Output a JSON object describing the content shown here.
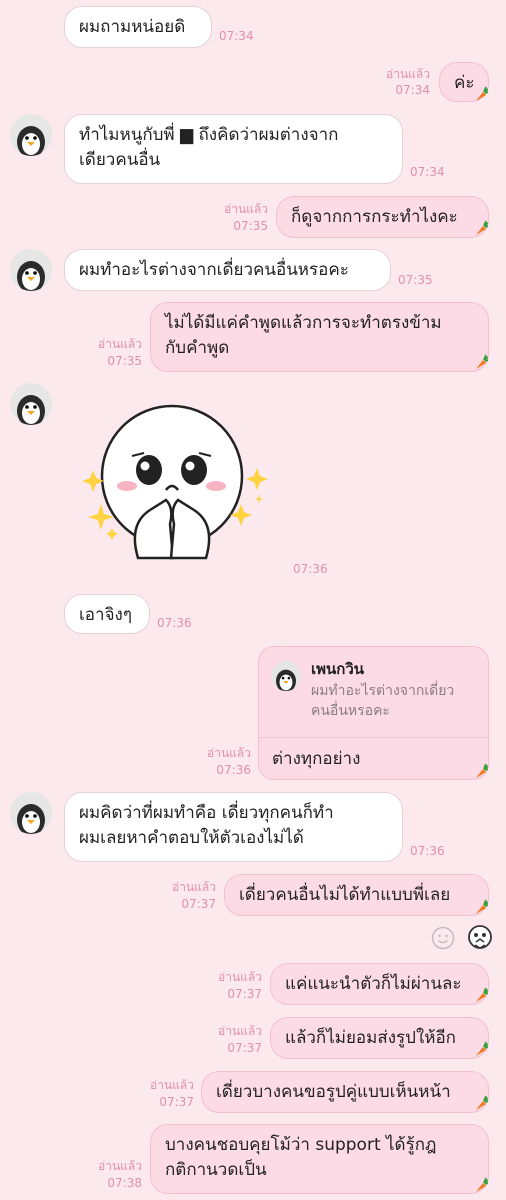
{
  "messages": [
    {
      "text": "ผมถามหน่อยดิ",
      "time": "07:34"
    },
    {
      "read": "อ่านแล้ว",
      "text": "ค่ะ",
      "time": "07:34"
    },
    {
      "text": "ทำไมหนูกับพี่ ▆ ถึงคิดว่าผมต่างจาก\nเดียวคนอื่น",
      "time": "07:34"
    },
    {
      "read": "อ่านแล้ว",
      "text": "ก็ดูจากการกระทำไงคะ",
      "time": "07:35"
    },
    {
      "text": "ผมทำอะไรต่างจากเดี่ยวคนอื่นหรอคะ",
      "time": "07:35"
    },
    {
      "read": "อ่านแล้ว",
      "text": "ไม่ได้มีแค่คำพูดแล้วการจะทำตรงข้าม\nกับคำพูด",
      "time": "07:35"
    },
    {
      "sticker": "crying-face-sticker",
      "time": "07:36"
    },
    {
      "text": "เอาจิงๆ",
      "time": "07:36"
    },
    {
      "read": "อ่านแล้ว",
      "quote_name": "เพนกวิน",
      "quote_text": "ผมทำอะไรต่างจากเดี่ยว\nคนอื่นหรอคะ",
      "text": "ต่างทุกอย่าง",
      "time": "07:36"
    },
    {
      "text": "ผมคิดว่าที่ผมทำคือ เดี่ยวทุกคนก็ทำ\nผมเลยหาคำตอบให้ตัวเองไม่ได้",
      "time": "07:36"
    },
    {
      "read": "อ่านแล้ว",
      "text": "เดี่ยวคนอื่นไม่ได้ทำแบบพี่เลย",
      "time": "07:37"
    },
    {
      "read": "อ่านแล้ว",
      "text": "แค่แนะนำตัวก็ไม่ผ่านละ",
      "time": "07:37"
    },
    {
      "read": "อ่านแล้ว",
      "text": "แล้วก็ไม่ยอมส่งรูปให้อีก",
      "time": "07:37"
    },
    {
      "read": "อ่านแล้ว",
      "text": "เดี่ยวบางคนขอรูปคู่แบบเห็นหน้า",
      "time": "07:37"
    },
    {
      "read": "อ่านแล้ว",
      "text": "บางคนชอบคุยโม้ว่า support ได้รู้กฎ\nกติกานวดเป็น",
      "time": "07:38"
    }
  ],
  "colors": {
    "background": "#fbe9ee",
    "outgoing": "#fcdbe6",
    "incoming": "#ffffff",
    "timestamp": "#e190ab"
  }
}
